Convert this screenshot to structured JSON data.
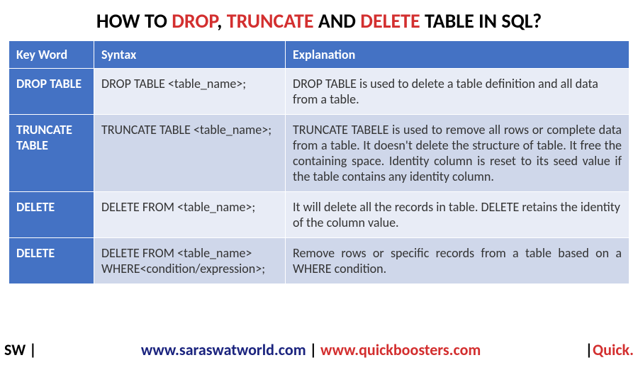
{
  "title": {
    "t1": "HOW TO ",
    "drop": "DROP",
    "comma": ", ",
    "truncate": "TRUNCATE",
    "and": " AND ",
    "delete": "DELETE",
    "t2": " TABLE IN SQL?"
  },
  "headers": {
    "c1": "Key Word",
    "c2": "Syntax",
    "c3": "Explanation"
  },
  "rows": [
    {
      "keyword": "DROP TABLE",
      "syntax": "DROP TABLE <table_name>;",
      "explanation": "DROP TABLE is used to delete a table definition and all data from a table."
    },
    {
      "keyword": "TRUNCATE TABLE",
      "syntax": "TRUNCATE TABLE <table_name>;",
      "explanation": "TRUNCATE TABELE is used to remove all rows or complete data from a table. It doesn't delete the structure of table. It free the containing space. Identity column is reset to its seed value if the table contains any identity column."
    },
    {
      "keyword": "DELETE",
      "syntax": "DELETE FROM <table_name>;",
      "explanation": "It will delete all the records in table. DELETE retains the identity of the column value."
    },
    {
      "keyword": "DELETE",
      "syntax": "DELETE FROM <table_name> WHERE<condition/expression>;",
      "explanation": "Remove rows or specific records from a table based on a WHERE condition."
    }
  ],
  "footer": {
    "left": "SW |",
    "site1": "www.saraswatworld.com",
    "sep": " | ",
    "site2": "www.quickboosters.com",
    "rbar": "|",
    "rtext": "Quick."
  }
}
